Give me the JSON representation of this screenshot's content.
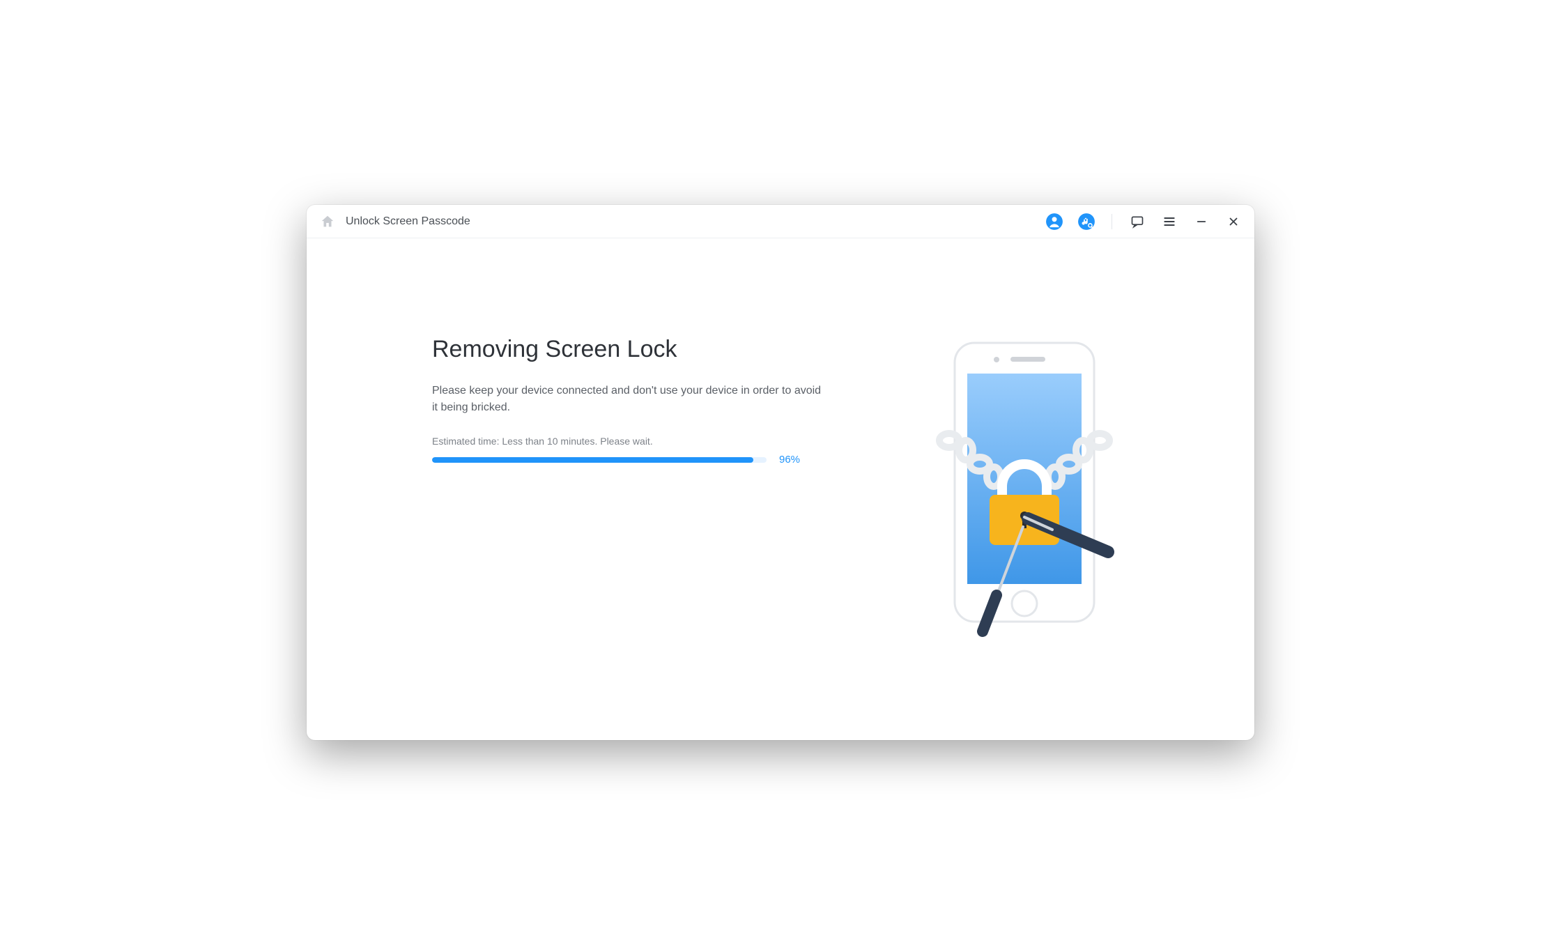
{
  "titlebar": {
    "title": "Unlock Screen Passcode"
  },
  "main": {
    "heading": "Removing Screen Lock",
    "description": "Please keep your device connected and don't use your device in order to avoid it being bricked.",
    "estimate": "Estimated time: Less than 10 minutes. Please wait.",
    "progress_percent": 96,
    "progress_label": "96%"
  },
  "colors": {
    "accent": "#2094fa",
    "lock": "#f7b41d",
    "screen_top": "#9acdfc",
    "screen_bottom": "#3f97e8",
    "tool": "#2e3d53"
  }
}
